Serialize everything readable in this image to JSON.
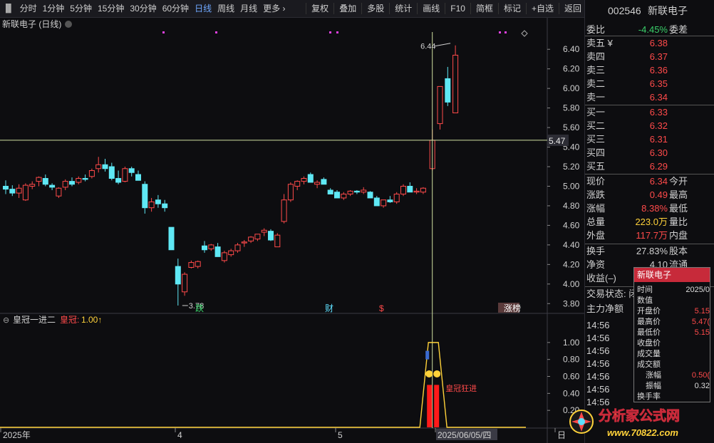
{
  "toolbar": {
    "periods": [
      "分时",
      "1分钟",
      "5分钟",
      "15分钟",
      "30分钟",
      "60分钟",
      "日线",
      "周线",
      "月线",
      "更多 ›"
    ],
    "active": "日线",
    "actions": [
      "复权",
      "叠加",
      "多股",
      "统计",
      "画线",
      "F10",
      "简框",
      "标记",
      "+自选",
      "返回"
    ]
  },
  "chart": {
    "title": "新联电子 (日线)",
    "price_ticks": [
      "6.40",
      "6.20",
      "6.00",
      "5.80",
      "5.60",
      "5.40",
      "5.20",
      "5.00",
      "4.80",
      "4.60",
      "4.40",
      "4.20",
      "4.00",
      "3.80"
    ],
    "crosshair_price": "5.47",
    "high_label": "6.44",
    "low_label": "3.78",
    "event_markers": [
      {
        "text": "跌",
        "color": "#3ad06a"
      },
      {
        "text": "财",
        "color": "#5fe0ff"
      },
      {
        "text": "$",
        "color": "#ff4a4a"
      },
      {
        "text": "涨榜",
        "color": "#ffffff"
      }
    ],
    "x_labels": [
      "2025年",
      "4",
      "5",
      "2025/06/05/四",
      "日"
    ],
    "candle_colors": {
      "up": "#ff4a4a",
      "down": "#5fe8f5"
    }
  },
  "chart_data": {
    "type": "candlestick",
    "series": [
      [
        5.0,
        5.06,
        4.92,
        4.97
      ],
      [
        4.97,
        5.01,
        4.9,
        4.93
      ],
      [
        4.93,
        5.02,
        4.88,
        4.98
      ],
      [
        4.86,
        5.03,
        4.85,
        5.01
      ],
      [
        5.0,
        5.05,
        4.97,
        5.02
      ],
      [
        5.05,
        5.1,
        5.0,
        5.09
      ],
      [
        5.08,
        5.12,
        5.0,
        5.02
      ],
      [
        5.01,
        5.03,
        4.96,
        4.99
      ],
      [
        4.9,
        4.99,
        4.88,
        4.98
      ],
      [
        4.99,
        5.07,
        4.96,
        5.05
      ],
      [
        5.05,
        5.09,
        5.0,
        5.02
      ],
      [
        5.04,
        5.1,
        5.02,
        5.08
      ],
      [
        5.08,
        5.12,
        5.05,
        5.07
      ],
      [
        5.1,
        5.18,
        5.08,
        5.16
      ],
      [
        5.18,
        5.3,
        5.14,
        5.22
      ],
      [
        5.22,
        5.28,
        5.15,
        5.18
      ],
      [
        5.2,
        5.24,
        5.06,
        5.08
      ],
      [
        5.08,
        5.16,
        5.02,
        5.04
      ],
      [
        5.05,
        5.2,
        5.04,
        5.18
      ],
      [
        5.18,
        5.2,
        5.1,
        5.14
      ],
      [
        5.12,
        5.16,
        5.06,
        5.06
      ],
      [
        5.02,
        5.05,
        4.72,
        4.78
      ],
      [
        4.78,
        4.88,
        4.74,
        4.84
      ],
      [
        4.86,
        4.91,
        4.78,
        4.82
      ],
      [
        4.82,
        4.86,
        4.74,
        4.78
      ],
      [
        4.58,
        4.58,
        4.35,
        4.35
      ],
      [
        4.18,
        4.26,
        3.78,
        4.0
      ],
      [
        3.92,
        4.12,
        3.88,
        4.1
      ],
      [
        4.17,
        4.24,
        4.16,
        4.22
      ],
      [
        4.18,
        4.24,
        4.16,
        4.23
      ],
      [
        4.39,
        4.44,
        4.32,
        4.35
      ],
      [
        4.36,
        4.41,
        4.34,
        4.4
      ],
      [
        4.38,
        4.42,
        4.28,
        4.28
      ],
      [
        4.24,
        4.34,
        4.22,
        4.32
      ],
      [
        4.3,
        4.36,
        4.28,
        4.34
      ],
      [
        4.34,
        4.42,
        4.32,
        4.4
      ],
      [
        4.42,
        4.45,
        4.38,
        4.43
      ],
      [
        4.44,
        4.49,
        4.42,
        4.48
      ],
      [
        4.46,
        4.51,
        4.44,
        4.51
      ],
      [
        4.53,
        4.57,
        4.49,
        4.55
      ],
      [
        4.54,
        4.56,
        4.44,
        4.45
      ],
      [
        4.38,
        4.52,
        4.38,
        4.5
      ],
      [
        4.64,
        4.92,
        4.62,
        4.86
      ],
      [
        4.86,
        5.04,
        4.84,
        5.02
      ],
      [
        5.0,
        5.06,
        4.96,
        5.05
      ],
      [
        5.05,
        5.1,
        5.02,
        5.08
      ],
      [
        5.12,
        5.14,
        5.04,
        5.04
      ],
      [
        5.02,
        5.06,
        4.98,
        5.04
      ],
      [
        5.07,
        5.09,
        5.02,
        5.02
      ],
      [
        4.96,
        4.98,
        4.92,
        4.92
      ],
      [
        4.94,
        4.96,
        4.88,
        4.88
      ],
      [
        4.88,
        4.94,
        4.86,
        4.92
      ],
      [
        4.92,
        4.96,
        4.9,
        4.95
      ],
      [
        4.95,
        4.96,
        4.92,
        4.94
      ],
      [
        4.94,
        4.99,
        4.92,
        4.96
      ],
      [
        4.94,
        4.95,
        4.88,
        4.88
      ],
      [
        4.88,
        4.9,
        4.8,
        4.8
      ],
      [
        4.8,
        4.86,
        4.78,
        4.86
      ],
      [
        4.86,
        4.9,
        4.83,
        4.84
      ],
      [
        4.84,
        4.94,
        4.82,
        4.92
      ],
      [
        4.92,
        5.02,
        4.9,
        5.0
      ],
      [
        5.0,
        5.04,
        4.94,
        4.94
      ],
      [
        4.94,
        4.98,
        4.92,
        4.95
      ],
      [
        4.94,
        4.99,
        4.92,
        4.98
      ],
      [
        5.18,
        5.58,
        5.16,
        5.47
      ],
      [
        5.64,
        5.96,
        5.58,
        6.02
      ],
      [
        6.1,
        6.22,
        5.82,
        5.86
      ],
      [
        5.75,
        6.44,
        5.75,
        6.34
      ]
    ]
  },
  "indicator": {
    "name": "皇冠一进二",
    "label": "皇冠:",
    "value": "1.00↑",
    "ticks": [
      "1.00",
      "0.80",
      "0.60",
      "0.40",
      "0.20"
    ],
    "annotation": "皇冠狂进",
    "line_values": [
      0,
      0,
      0,
      0,
      1,
      1,
      0,
      0
    ],
    "bars": [
      0.5,
      0.5
    ]
  },
  "panel": {
    "code": "002546",
    "name": "新联电子",
    "webi_label": "委比",
    "webi_value": "-4.45%",
    "weicha_label": "委差",
    "sells": [
      {
        "label": "卖五 ¥",
        "price": "6.38"
      },
      {
        "label": "卖四",
        "price": "6.37"
      },
      {
        "label": "卖三",
        "price": "6.36"
      },
      {
        "label": "卖二",
        "price": "6.35"
      },
      {
        "label": "卖一",
        "price": "6.34"
      }
    ],
    "buys": [
      {
        "label": "买一",
        "price": "6.33"
      },
      {
        "label": "买二",
        "price": "6.32"
      },
      {
        "label": "买三",
        "price": "6.31"
      },
      {
        "label": "买四",
        "price": "6.30"
      },
      {
        "label": "买五",
        "price": "6.29"
      }
    ],
    "stats": [
      {
        "label": "现价",
        "value": "6.34",
        "right": "今开"
      },
      {
        "label": "涨跌",
        "value": "0.49",
        "right": "最高"
      },
      {
        "label": "涨幅",
        "value": "8.38%",
        "right": "最低"
      },
      {
        "label": "总量",
        "value": "223.0万",
        "right": "量比"
      },
      {
        "label": "外盘",
        "value": "117.7万",
        "right": "内盘"
      }
    ],
    "stats2": [
      {
        "label": "换手",
        "value": "27.83%",
        "right": "股本"
      },
      {
        "label": "净资",
        "value": "4.10",
        "right": "流通"
      },
      {
        "label": "收益(–)",
        "value": "",
        "right": ""
      }
    ],
    "trade_state": "交易状态: 闭",
    "main_flow": "主力净额",
    "times": [
      "14:56",
      "14:56",
      "14:56",
      "14:56",
      "14:56",
      "14:56",
      "14:56"
    ]
  },
  "tooltip": {
    "title": "新联电子",
    "rows": [
      {
        "k": "时间",
        "v": "2025/0"
      },
      {
        "k": "数值",
        "v": ""
      },
      {
        "k": "开盘价",
        "v": "5.15"
      },
      {
        "k": "最高价",
        "v": "5.47("
      },
      {
        "k": "最低价",
        "v": "5.15"
      },
      {
        "k": "收盘价",
        "v": ""
      },
      {
        "k": "成交量",
        "v": ""
      },
      {
        "k": "成交额",
        "v": ""
      },
      {
        "k": "涨幅",
        "v": "0.50("
      },
      {
        "k": "振幅",
        "v": "0.32"
      },
      {
        "k": "换手率",
        "v": ""
      }
    ]
  },
  "watermark": {
    "text": "分析家公式网",
    "url": "www.70822.com"
  }
}
